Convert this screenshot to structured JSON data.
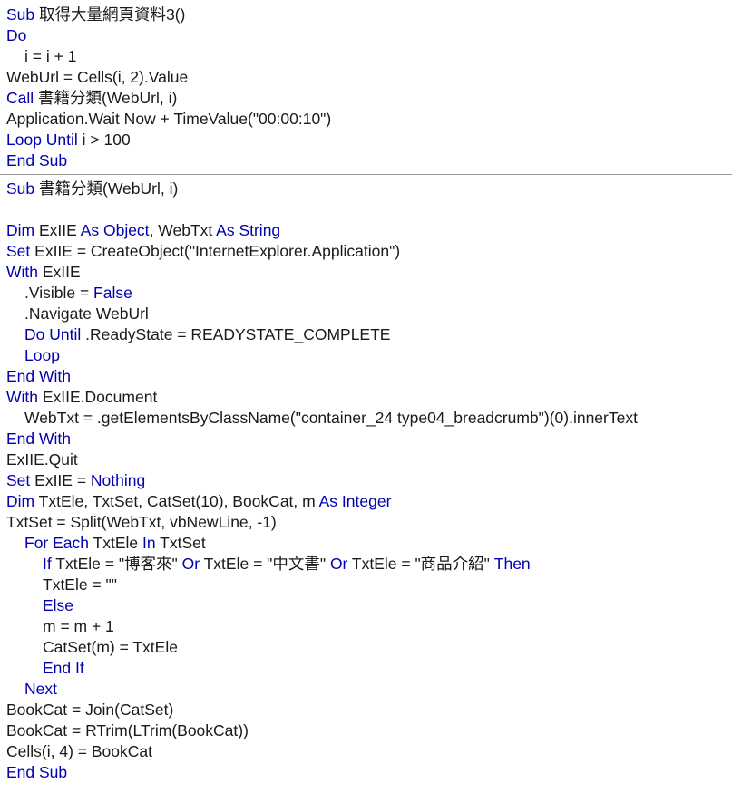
{
  "colors": {
    "keyword": "#0000b0",
    "text": "#1a1a1a",
    "separator": "#9a9a9a",
    "background": "#ffffff"
  },
  "blocks": [
    {
      "lines": [
        {
          "indent": 0,
          "tokens": [
            {
              "t": "Sub",
              "k": true
            },
            {
              "t": " 取得大量網頁資料3()",
              "k": false
            }
          ]
        },
        {
          "indent": 0,
          "tokens": [
            {
              "t": "Do",
              "k": true
            }
          ]
        },
        {
          "indent": 1,
          "tokens": [
            {
              "t": "i = i + 1",
              "k": false
            }
          ]
        },
        {
          "indent": 0,
          "tokens": [
            {
              "t": "WebUrl = Cells(i, 2).Value",
              "k": false
            }
          ]
        },
        {
          "indent": 0,
          "tokens": [
            {
              "t": "Call",
              "k": true
            },
            {
              "t": " 書籍分類(WebUrl, i)",
              "k": false
            }
          ]
        },
        {
          "indent": 0,
          "tokens": [
            {
              "t": "Application.Wait Now + TimeValue(\"00:00:10\")",
              "k": false
            }
          ]
        },
        {
          "indent": 0,
          "tokens": [
            {
              "t": "Loop Until",
              "k": true
            },
            {
              "t": " i > 100",
              "k": false
            }
          ]
        },
        {
          "indent": 0,
          "tokens": [
            {
              "t": "End Sub",
              "k": true
            }
          ]
        }
      ]
    },
    {
      "lines": [
        {
          "indent": 0,
          "tokens": [
            {
              "t": "Sub",
              "k": true
            },
            {
              "t": " 書籍分類(WebUrl, i)",
              "k": false
            }
          ]
        },
        {
          "indent": 0,
          "tokens": []
        },
        {
          "indent": 0,
          "tokens": [
            {
              "t": "Dim",
              "k": true
            },
            {
              "t": " ExIIE ",
              "k": false
            },
            {
              "t": "As Object",
              "k": true
            },
            {
              "t": ", WebTxt ",
              "k": false
            },
            {
              "t": "As String",
              "k": true
            }
          ]
        },
        {
          "indent": 0,
          "tokens": [
            {
              "t": "Set",
              "k": true
            },
            {
              "t": " ExIIE = CreateObject(\"InternetExplorer.Application\")",
              "k": false
            }
          ]
        },
        {
          "indent": 0,
          "tokens": [
            {
              "t": "With",
              "k": true
            },
            {
              "t": " ExIIE",
              "k": false
            }
          ]
        },
        {
          "indent": 1,
          "tokens": [
            {
              "t": ".Visible = ",
              "k": false
            },
            {
              "t": "False",
              "k": true
            }
          ]
        },
        {
          "indent": 1,
          "tokens": [
            {
              "t": ".Navigate WebUrl",
              "k": false
            }
          ]
        },
        {
          "indent": 1,
          "tokens": [
            {
              "t": "Do Until",
              "k": true
            },
            {
              "t": " .ReadyState = READYSTATE_COMPLETE",
              "k": false
            }
          ]
        },
        {
          "indent": 1,
          "tokens": [
            {
              "t": "Loop",
              "k": true
            }
          ]
        },
        {
          "indent": 0,
          "tokens": [
            {
              "t": "End With",
              "k": true
            }
          ]
        },
        {
          "indent": 0,
          "tokens": [
            {
              "t": "With",
              "k": true
            },
            {
              "t": " ExIIE.Document",
              "k": false
            }
          ]
        },
        {
          "indent": 1,
          "tokens": [
            {
              "t": "WebTxt = .getElementsByClassName(\"container_24 type04_breadcrumb\")(0).innerText",
              "k": false
            }
          ]
        },
        {
          "indent": 0,
          "tokens": [
            {
              "t": "End With",
              "k": true
            }
          ]
        },
        {
          "indent": 0,
          "tokens": [
            {
              "t": "ExIIE.Quit",
              "k": false
            }
          ]
        },
        {
          "indent": 0,
          "tokens": [
            {
              "t": "Set",
              "k": true
            },
            {
              "t": " ExIIE = ",
              "k": false
            },
            {
              "t": "Nothing",
              "k": true
            }
          ]
        },
        {
          "indent": 0,
          "tokens": [
            {
              "t": "Dim",
              "k": true
            },
            {
              "t": " TxtEle, TxtSet, CatSet(10), BookCat, m ",
              "k": false
            },
            {
              "t": "As Integer",
              "k": true
            }
          ]
        },
        {
          "indent": 0,
          "tokens": [
            {
              "t": "TxtSet = Split(WebTxt, vbNewLine, -1)",
              "k": false
            }
          ]
        },
        {
          "indent": 1,
          "tokens": [
            {
              "t": "For Each",
              "k": true
            },
            {
              "t": " TxtEle ",
              "k": false
            },
            {
              "t": "In",
              "k": true
            },
            {
              "t": " TxtSet",
              "k": false
            }
          ]
        },
        {
          "indent": 2,
          "tokens": [
            {
              "t": "If",
              "k": true
            },
            {
              "t": " TxtEle = \"博客來\" ",
              "k": false
            },
            {
              "t": "Or",
              "k": true
            },
            {
              "t": " TxtEle = \"中文書\" ",
              "k": false
            },
            {
              "t": "Or",
              "k": true
            },
            {
              "t": " TxtEle = \"商品介紹\" ",
              "k": false
            },
            {
              "t": "Then",
              "k": true
            }
          ]
        },
        {
          "indent": 2,
          "tokens": [
            {
              "t": "TxtEle = \"\"",
              "k": false
            }
          ]
        },
        {
          "indent": 2,
          "tokens": [
            {
              "t": "Else",
              "k": true
            }
          ]
        },
        {
          "indent": 2,
          "tokens": [
            {
              "t": "m = m + 1",
              "k": false
            }
          ]
        },
        {
          "indent": 2,
          "tokens": [
            {
              "t": "CatSet(m) = TxtEle",
              "k": false
            }
          ]
        },
        {
          "indent": 2,
          "tokens": [
            {
              "t": "End If",
              "k": true
            }
          ]
        },
        {
          "indent": 1,
          "tokens": [
            {
              "t": "Next",
              "k": true
            }
          ]
        },
        {
          "indent": 0,
          "tokens": [
            {
              "t": "BookCat = Join(CatSet)",
              "k": false
            }
          ]
        },
        {
          "indent": 0,
          "tokens": [
            {
              "t": "BookCat = RTrim(LTrim(BookCat))",
              "k": false
            }
          ]
        },
        {
          "indent": 0,
          "tokens": [
            {
              "t": "Cells(i, 4) = BookCat",
              "k": false
            }
          ]
        },
        {
          "indent": 0,
          "tokens": [
            {
              "t": "End Sub",
              "k": true
            }
          ]
        }
      ]
    }
  ]
}
